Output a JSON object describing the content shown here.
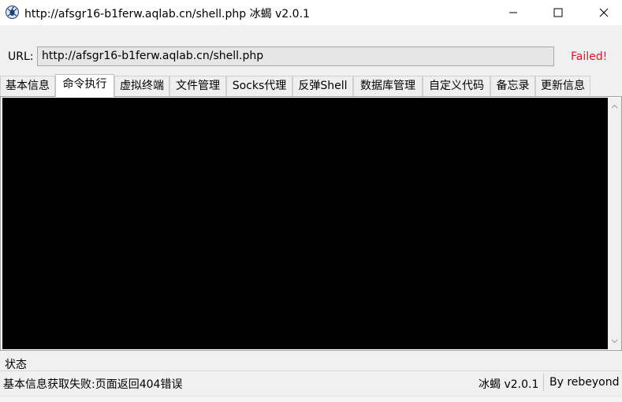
{
  "window": {
    "title": "http://afsgr16-b1ferw.aqlab.cn/shell.php    冰蝎 v2.0.1",
    "app_icon": "scorpion-icon",
    "controls": [
      "minimize-icon",
      "maximize-icon",
      "close-icon"
    ]
  },
  "url_bar": {
    "label": "URL:",
    "value": "http://afsgr16-b1ferw.aqlab.cn/shell.php",
    "status": "Failed!",
    "status_color": "#e81123"
  },
  "tabs": [
    {
      "label": "基本信息",
      "active": false
    },
    {
      "label": "命令执行",
      "active": true
    },
    {
      "label": "虚拟终端",
      "active": false
    },
    {
      "label": "文件管理",
      "active": false
    },
    {
      "label": "Socks代理",
      "active": false
    },
    {
      "label": "反弹Shell",
      "active": false
    },
    {
      "label": "数据库管理",
      "active": false
    },
    {
      "label": "自定义代码",
      "active": false
    },
    {
      "label": "备忘录",
      "active": false
    },
    {
      "label": "更新信息",
      "active": false
    }
  ],
  "terminal": {
    "background": "#000000"
  },
  "status_bar": {
    "title": "状态",
    "message": "基本信息获取失败:页面返回404错误",
    "version": "冰蝎 v2.0.1",
    "author": "By rebeyond"
  }
}
